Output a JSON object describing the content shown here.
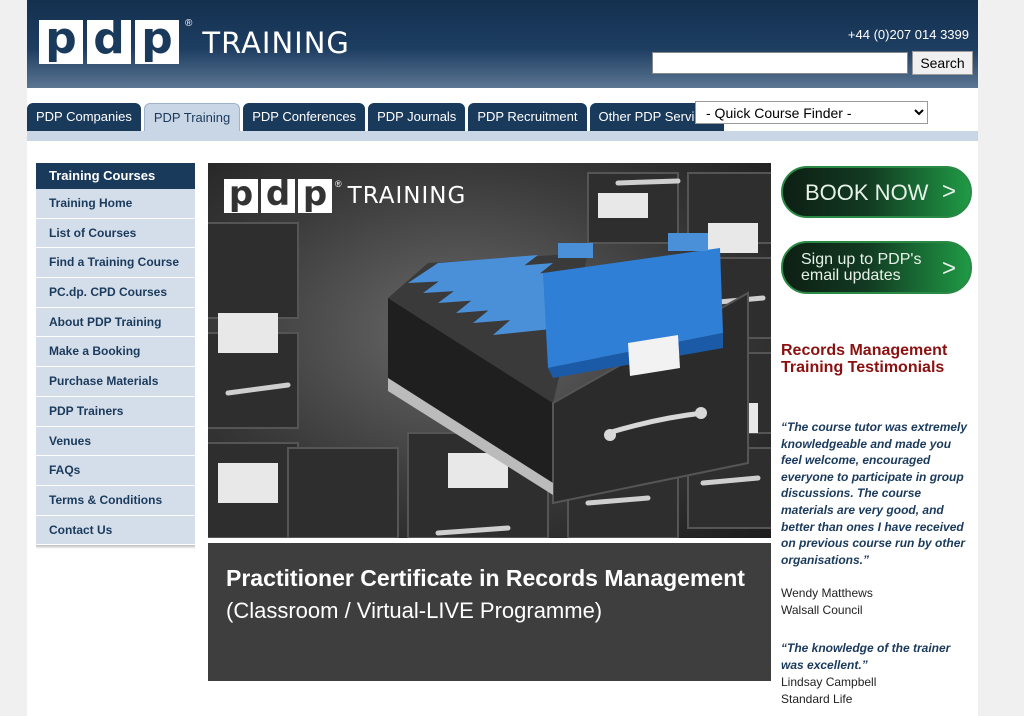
{
  "header": {
    "logo_letters": [
      "p",
      "d",
      "p"
    ],
    "logo_reg": "®",
    "logo_word": "TRAINING",
    "phone": "+44 (0)207 014 3399",
    "search_button": "Search"
  },
  "nav": {
    "tabs": [
      {
        "label": "PDP Companies",
        "active": false
      },
      {
        "label": "PDP Training",
        "active": true
      },
      {
        "label": "PDP Conferences",
        "active": false
      },
      {
        "label": "PDP Journals",
        "active": false
      },
      {
        "label": "PDP Recruitment",
        "active": false
      },
      {
        "label": "Other PDP Services",
        "active": false
      }
    ],
    "course_finder": "- Quick Course Finder -"
  },
  "sidebar": {
    "heading": "Training Courses",
    "items": [
      {
        "label": "Training Home"
      },
      {
        "label": "List of Courses"
      },
      {
        "label": "Find a Training Course"
      },
      {
        "label": "PC.dp. CPD Courses"
      },
      {
        "label": "About PDP Training"
      },
      {
        "label": "Make a Booking"
      },
      {
        "label": "Purchase Materials"
      },
      {
        "label": "PDP Trainers"
      },
      {
        "label": "Venues"
      },
      {
        "label": "FAQs"
      },
      {
        "label": "Terms & Conditions"
      },
      {
        "label": "Contact Us"
      }
    ]
  },
  "hero": {
    "logo_letters": [
      "p",
      "d",
      "p"
    ],
    "logo_reg": "®",
    "logo_word": "TRAINING",
    "title": "Practitioner Certificate in Records Management",
    "subtitle": "(Classroom / Virtual-LIVE Programme)"
  },
  "right": {
    "book_now": "BOOK NOW",
    "email_updates": "Sign up to PDP's email updates",
    "chevron": ">",
    "testimonials_title": "Records Management Training Testimonials",
    "testimonials": [
      {
        "quote": "“The course tutor was extremely knowledgeable and made you feel welcome, encouraged everyone to participate in group discussions. The course materials are very good, and better than ones I have received on previous course run by other organisations.”",
        "name": "Wendy Matthews",
        "org": "Walsall Council"
      },
      {
        "quote": "“The knowledge of the trainer was excellent.”",
        "name": "Lindsay Campbell",
        "org": "Standard Life"
      }
    ]
  },
  "colors": {
    "navy": "#1a3a5c",
    "sidebar_bg": "#d4deea",
    "testimonial_title": "#8b1010",
    "button_green": "#1f9a45"
  }
}
